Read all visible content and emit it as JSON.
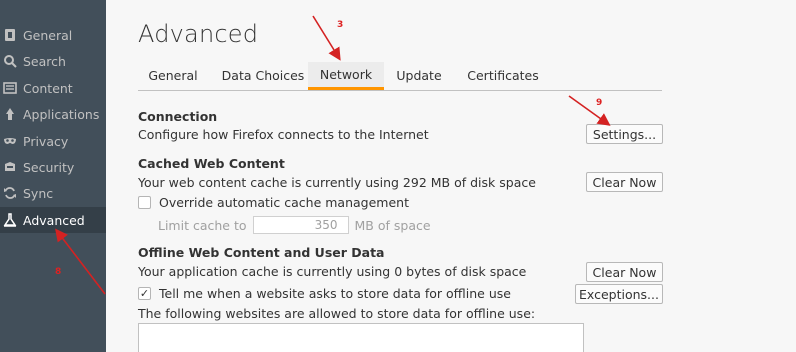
{
  "sidebar": {
    "items": [
      {
        "label": "General",
        "icon": "general-icon"
      },
      {
        "label": "Search",
        "icon": "search-icon"
      },
      {
        "label": "Content",
        "icon": "content-icon"
      },
      {
        "label": "Applications",
        "icon": "applications-icon"
      },
      {
        "label": "Privacy",
        "icon": "privacy-mask-icon"
      },
      {
        "label": "Security",
        "icon": "security-icon"
      },
      {
        "label": "Sync",
        "icon": "sync-icon"
      },
      {
        "label": "Advanced",
        "icon": "advanced-icon",
        "selected": true
      }
    ]
  },
  "header": {
    "title": "Advanced"
  },
  "tabs": [
    {
      "label": "General"
    },
    {
      "label": "Data Choices"
    },
    {
      "label": "Network",
      "selected": true
    },
    {
      "label": "Update"
    },
    {
      "label": "Certificates"
    }
  ],
  "connection": {
    "title": "Connection",
    "desc": "Configure how Firefox connects to the Internet",
    "settings_button": "Settings..."
  },
  "cache": {
    "title": "Cached Web Content",
    "desc": "Your web content cache is currently using 292 MB of disk space",
    "clear_button": "Clear Now",
    "override_label": "Override automatic cache management",
    "override_checked": false,
    "limit_label": "Limit cache to",
    "limit_value": "350",
    "limit_unit": "MB of space"
  },
  "offline": {
    "title": "Offline Web Content and User Data",
    "desc": "Your application cache is currently using 0 bytes of disk space",
    "clear_button": "Clear Now",
    "tell_label": "Tell me when a website asks to store data for offline use",
    "tell_checked": true,
    "tell_check_glyph": "✓",
    "exceptions_button": "Exceptions...",
    "allowed_label": "The following websites are allowed to store data for offline use:"
  },
  "annotations": {
    "tab_step": "3",
    "settings_step": "9",
    "sidebar_step": "8",
    "color": "#d42222"
  },
  "colors": {
    "sidebar_bg": "#424f5a",
    "sidebar_selected": "#343f48",
    "tab_accent": "#ff9500",
    "page_bg": "#f7f7f7"
  }
}
